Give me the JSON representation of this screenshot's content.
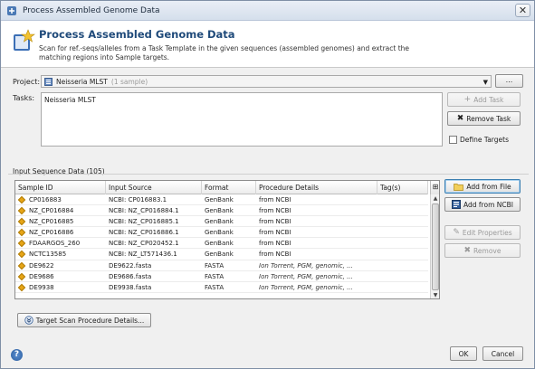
{
  "window": {
    "title": "Process Assembled Genome Data",
    "close_label": "✕"
  },
  "header": {
    "title": "Process Assembled Genome Data",
    "description": "Scan for ref.-seqs/alleles from a Task Template in the given sequences (assembled genomes) and extract the matching regions into Sample targets."
  },
  "project": {
    "label": "Project:",
    "value": "Neisseria MLST",
    "sub": "(1 sample)",
    "browse_label": "..."
  },
  "tasks": {
    "label": "Tasks:",
    "value": "Neisseria MLST",
    "add_task": "Add Task",
    "remove_task": "Remove Task",
    "define_targets": "Define Targets"
  },
  "input": {
    "group_label": "Input Sequence Data (105)",
    "columns": [
      "Sample ID",
      "Input Source",
      "Format",
      "Procedure Details",
      "Tag(s)"
    ],
    "rows": [
      [
        "CP016883",
        "NCBI: CP016883.1",
        "GenBank",
        "from NCBI",
        ""
      ],
      [
        "NZ_CP016884",
        "NCBI: NZ_CP016884.1",
        "GenBank",
        "from NCBI",
        ""
      ],
      [
        "NZ_CP016885",
        "NCBI: NZ_CP016885.1",
        "GenBank",
        "from NCBI",
        ""
      ],
      [
        "NZ_CP016886",
        "NCBI: NZ_CP016886.1",
        "GenBank",
        "from NCBI",
        ""
      ],
      [
        "FDAARGOS_260",
        "NCBI: NZ_CP020452.1",
        "GenBank",
        "from NCBI",
        ""
      ],
      [
        "NCTC13585",
        "NCBI: NZ_LT571436.1",
        "GenBank",
        "from NCBI",
        ""
      ],
      [
        "DE9622",
        "DE9622.fasta",
        "FASTA",
        "Ion Torrent, PGM, genomic, ...",
        ""
      ],
      [
        "DE9686",
        "DE9686.fasta",
        "FASTA",
        "Ion Torrent, PGM, genomic, ...",
        ""
      ],
      [
        "DE9938",
        "DE9938.fasta",
        "FASTA",
        "Ion Torrent, PGM, genomic, ...",
        ""
      ]
    ],
    "add_from_file": "Add from File",
    "add_from_ncbi": "Add from NCBI",
    "edit_properties": "Edit Properties",
    "remove": "Remove",
    "target_scan_details": "Target Scan Procedure Details..."
  },
  "footer": {
    "ok": "OK",
    "cancel": "Cancel",
    "help": "?"
  },
  "colors": {
    "title_blue": "#1f4a7a",
    "accent_orange": "#e6a516"
  },
  "icons": [
    "app-icon",
    "close-icon",
    "wizard-star-icon",
    "database-icon",
    "chevron-down-icon",
    "plus-icon",
    "x-icon",
    "folder-icon",
    "ncbi-icon",
    "edit-icon",
    "column-chooser-icon",
    "expand-icon",
    "help-icon"
  ]
}
